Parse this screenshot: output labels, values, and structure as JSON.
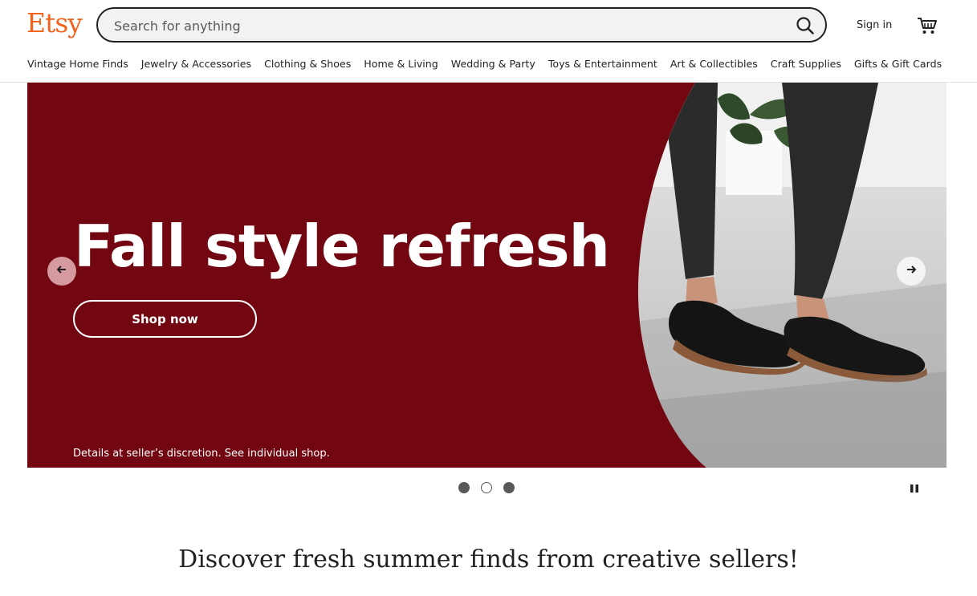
{
  "header": {
    "logo": "Etsy",
    "search": {
      "placeholder": "Search for anything",
      "value": ""
    },
    "sign_in": "Sign in",
    "icons": {
      "search": "search-icon",
      "cart": "cart-icon"
    }
  },
  "nav": {
    "items": [
      "Vintage Home Finds",
      "Jewelry & Accessories",
      "Clothing & Shoes",
      "Home & Living",
      "Wedding & Party",
      "Toys & Entertainment",
      "Art & Collectibles",
      "Craft Supplies",
      "Gifts & Gift Cards"
    ]
  },
  "hero": {
    "title": "Fall style refresh",
    "button": "Shop now",
    "disclaimer": "Details at seller’s discretion. See individual shop.",
    "background_color": "#720711",
    "icons": {
      "prev": "arrow-left-icon",
      "next": "arrow-right-icon"
    }
  },
  "carousel": {
    "slide_count": 3,
    "current_slide": 2,
    "pause_icon": "pause-icon"
  },
  "main": {
    "headline": "Discover fresh summer finds from creative sellers!"
  },
  "colors": {
    "brand": "#f1641e",
    "text": "#222222"
  }
}
